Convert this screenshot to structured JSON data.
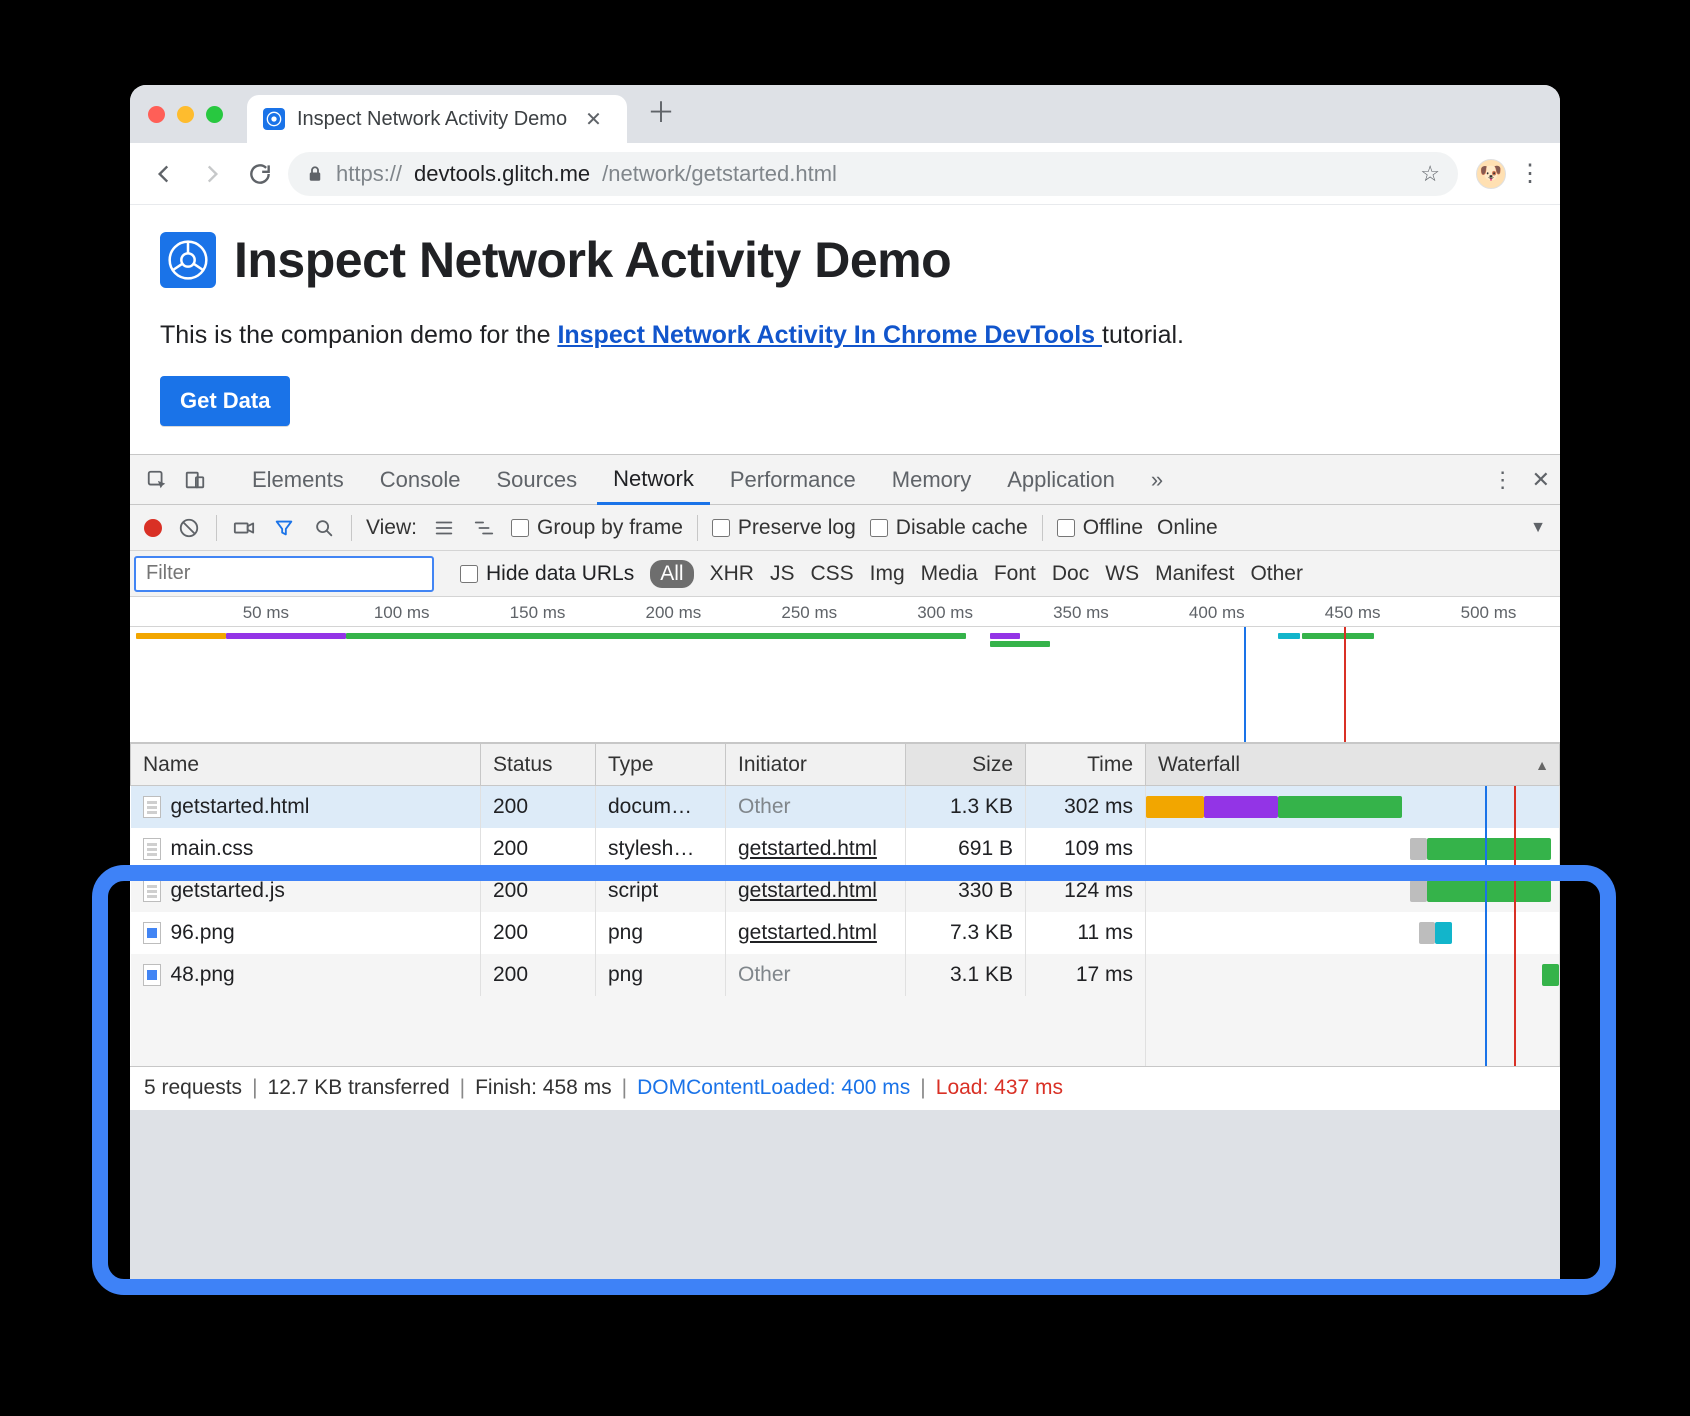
{
  "browser_tab": {
    "title": "Inspect Network Activity Demo"
  },
  "url": {
    "scheme": "https://",
    "host": "devtools.glitch.me",
    "path": "/network/getstarted.html"
  },
  "page": {
    "heading": "Inspect Network Activity Demo",
    "sub_pre": "This is the companion demo for the ",
    "sub_link": "Inspect Network Activity In Chrome DevTools ",
    "sub_post": "tutorial.",
    "button": "Get Data"
  },
  "devtools": {
    "tabs": [
      "Elements",
      "Console",
      "Sources",
      "Network",
      "Performance",
      "Memory",
      "Application"
    ],
    "active_tab": "Network",
    "overflow": "»",
    "toolbar": {
      "view_label": "View:",
      "group_by_frame": "Group by frame",
      "preserve_log": "Preserve log",
      "disable_cache": "Disable cache",
      "offline": "Offline",
      "online": "Online"
    },
    "filter": {
      "placeholder": "Filter",
      "hide_data_urls": "Hide data URLs",
      "types": [
        "All",
        "XHR",
        "JS",
        "CSS",
        "Img",
        "Media",
        "Font",
        "Doc",
        "WS",
        "Manifest",
        "Other"
      ],
      "active_type": "All"
    },
    "ruler_ticks": [
      "50 ms",
      "100 ms",
      "150 ms",
      "200 ms",
      "250 ms",
      "300 ms",
      "350 ms",
      "400 ms",
      "450 ms",
      "500 ms"
    ],
    "columns": [
      "Name",
      "Status",
      "Type",
      "Initiator",
      "Size",
      "Time",
      "Waterfall"
    ],
    "rows": [
      {
        "name": "getstarted.html",
        "status": "200",
        "type": "docum…",
        "initiator": "Other",
        "initiator_link": false,
        "size": "1.3 KB",
        "time": "302 ms"
      },
      {
        "name": "main.css",
        "status": "200",
        "type": "stylesh…",
        "initiator": "getstarted.html",
        "initiator_link": true,
        "size": "691 B",
        "time": "109 ms"
      },
      {
        "name": "getstarted.js",
        "status": "200",
        "type": "script",
        "initiator": "getstarted.html",
        "initiator_link": true,
        "size": "330 B",
        "time": "124 ms"
      },
      {
        "name": "96.png",
        "status": "200",
        "type": "png",
        "initiator": "getstarted.html",
        "initiator_link": true,
        "size": "7.3 KB",
        "time": "11 ms",
        "img": true
      },
      {
        "name": "48.png",
        "status": "200",
        "type": "png",
        "initiator": "Other",
        "initiator_link": false,
        "size": "3.1 KB",
        "time": "17 ms",
        "img": true
      }
    ],
    "status": {
      "requests": "5 requests",
      "transferred": "12.7 KB transferred",
      "finish": "Finish: 458 ms",
      "dcl": "DOMContentLoaded: 400 ms",
      "load": "Load: 437 ms"
    }
  }
}
